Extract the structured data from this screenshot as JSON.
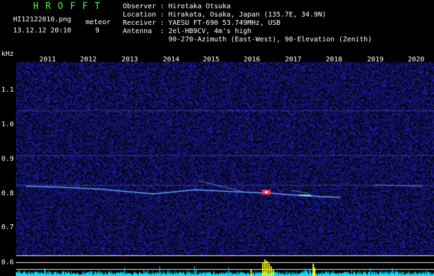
{
  "header": {
    "logo": "HROFFT",
    "filename": "HI12122010.png",
    "datetime": "13.12.12 20:10",
    "meteor_label": "meteor",
    "meteor_count": "9",
    "observer_key": "Observer",
    "observer": "Hirotaka Otsuka",
    "location_key": "Location",
    "location": "Hirakata, Osaka, Japan (135.7E, 34.9N)",
    "receiver_key": "Receiver",
    "receiver": "YAESU FT-690 53.749MHz, USB",
    "antenna_key": "Antenna",
    "antenna": "2el-HB9CV, 4m's high",
    "antenna_line2": "90-270-Azimuth (East-West), 90-Elevation (Zenith)",
    "sep": ":"
  },
  "axis": {
    "y_unit": "kHz",
    "years": [
      "2011",
      "2012",
      "2013",
      "2014",
      "2015",
      "2016",
      "2017",
      "2018",
      "2019",
      "2020"
    ],
    "y_ticks": [
      "1.1",
      "1.0",
      "0.9",
      "0.8",
      "0.7",
      "0.6"
    ]
  },
  "colors": {
    "background": "#000000",
    "noise": "#1a1a9a",
    "grid": "#ffffff",
    "meteor_trace": "#6aa0ff",
    "meteor_core": "#ff3344",
    "power_signal": "#00e0ff",
    "power_peak": "#ffff00",
    "logo": "#44ff44"
  }
}
